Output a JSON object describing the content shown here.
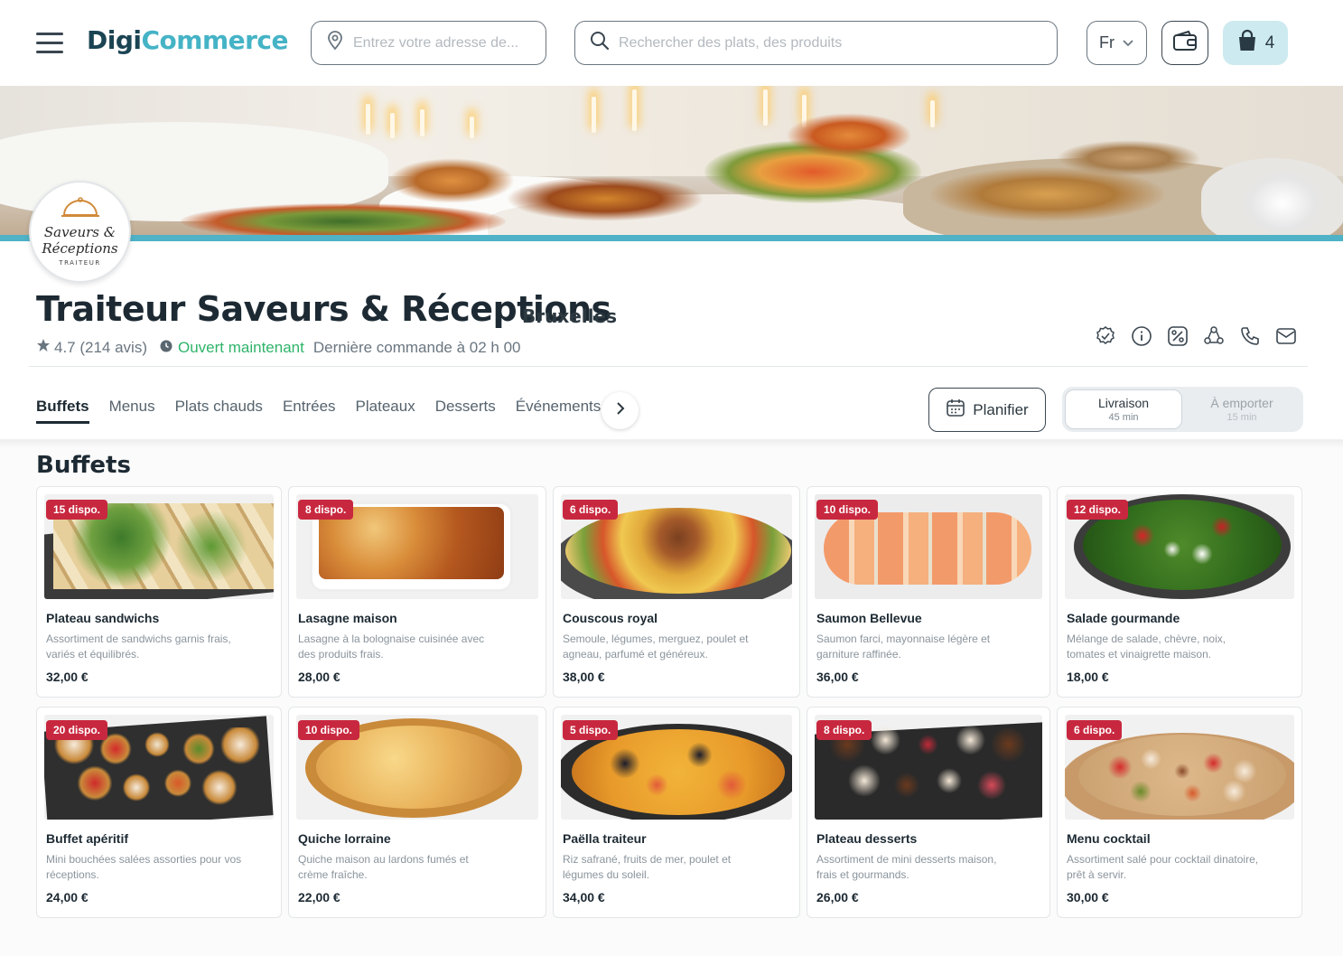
{
  "header": {
    "logo_part1": "Digi",
    "logo_part2": "Commerce",
    "address_placeholder": "Entrez votre adresse de...",
    "search_placeholder": "Rechercher des plats, des produits",
    "language": "Fr",
    "cart_count": "4"
  },
  "restaurant": {
    "logo_line1": "Saveurs &",
    "logo_line2": "Réceptions",
    "logo_line3": "TRAITEUR",
    "name": "Traiteur Saveurs & Réceptions",
    "city": "Bruxelles",
    "rating": "4.7 (214 avis)",
    "status": "Ouvert maintenant",
    "last_order": "Dernière commande à 02 h 00"
  },
  "tabs": [
    "Buffets",
    "Menus",
    "Plats chauds",
    "Entrées",
    "Plateaux",
    "Desserts",
    "Événements"
  ],
  "active_tab": "Buffets",
  "plan_label": "Planifier",
  "delivery": {
    "option1_label": "Livraison",
    "option1_time": "45 min",
    "option2_label": "À emporter",
    "option2_time": "15 min"
  },
  "section_title": "Buffets",
  "products": [
    {
      "badge": "15 dispo.",
      "title": "Plateau sandwichs",
      "desc": "Assortiment de sandwichs garnis frais, variés et équilibrés.",
      "price": "32,00 €",
      "style": "sandwich"
    },
    {
      "badge": "8 dispo.",
      "title": "Lasagne maison",
      "desc": "Lasagne à la bolognaise cuisinée avec des produits frais.",
      "price": "28,00 €",
      "style": "lasagne"
    },
    {
      "badge": "6 dispo.",
      "title": "Couscous royal",
      "desc": "Semoule, légumes, merguez, poulet et agneau, parfumé et généreux.",
      "price": "38,00 €",
      "style": "couscous"
    },
    {
      "badge": "10 dispo.",
      "title": "Saumon Bellevue",
      "desc": "Saumon farci, mayonnaise légère et garniture raffinée.",
      "price": "36,00 €",
      "style": "saumon"
    },
    {
      "badge": "12 dispo.",
      "title": "Salade gourmande",
      "desc": "Mélange de salade, chèvre, noix, tomates et vinaigrette maison.",
      "price": "18,00 €",
      "style": "salade"
    },
    {
      "badge": "20 dispo.",
      "title": "Buffet apéritif",
      "desc": "Mini bouchées salées assorties pour vos réceptions.",
      "price": "24,00 €",
      "style": "aperitif"
    },
    {
      "badge": "10 dispo.",
      "title": "Quiche lorraine",
      "desc": "Quiche maison au lardons fumés et crème fraîche.",
      "price": "22,00 €",
      "style": "quiche"
    },
    {
      "badge": "5 dispo.",
      "title": "Paëlla traiteur",
      "desc": "Riz safrané, fruits de mer, poulet et légumes du soleil.",
      "price": "34,00 €",
      "style": "paella"
    },
    {
      "badge": "8 dispo.",
      "title": "Plateau desserts",
      "desc": "Assortiment de mini desserts maison, frais et gourmands.",
      "price": "26,00 €",
      "style": "desserts"
    },
    {
      "badge": "6 dispo.",
      "title": "Menu cocktail",
      "desc": "Assortiment salé pour cocktail dinatoire, prêt à servir.",
      "price": "30,00 €",
      "style": "cocktail"
    }
  ],
  "colors": {
    "accent": "#4fb2c6",
    "brand_dark": "#1b4453",
    "open_green": "#2fb46a",
    "badge_red": "#c8283f"
  }
}
